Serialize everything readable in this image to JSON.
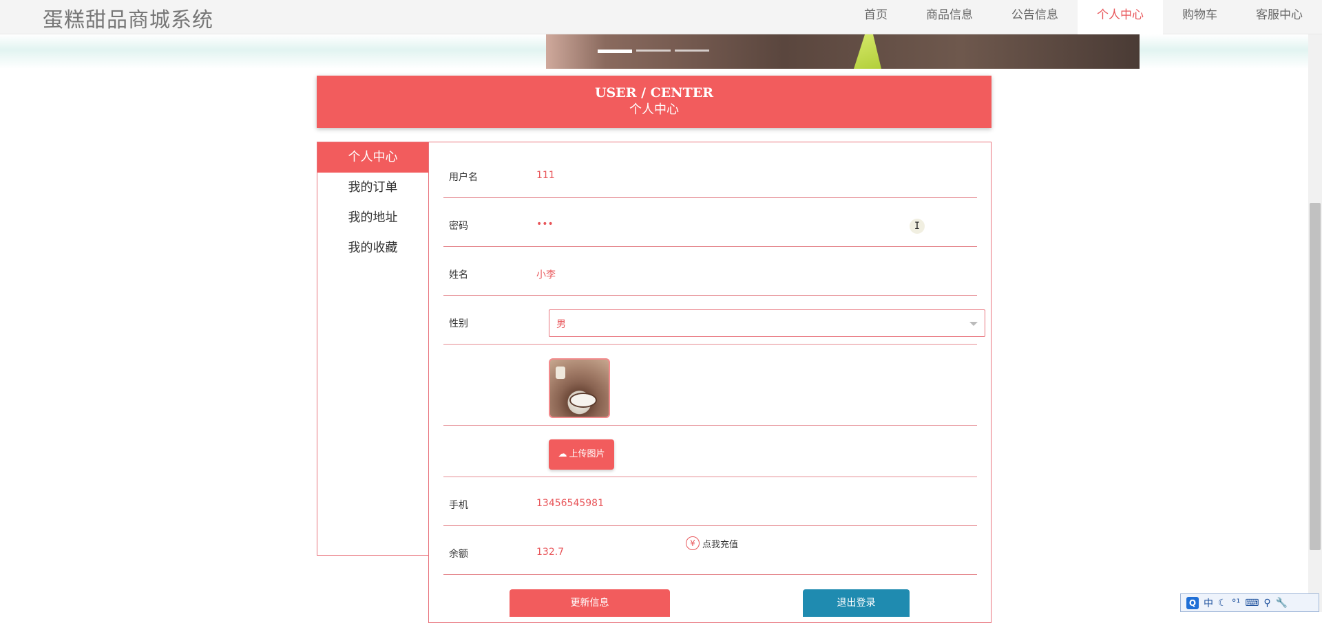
{
  "site": {
    "title": "蛋糕甜品商城系统"
  },
  "nav": {
    "items": [
      {
        "label": "首页"
      },
      {
        "label": "商品信息"
      },
      {
        "label": "公告信息"
      },
      {
        "label": "个人中心"
      },
      {
        "label": "购物车"
      },
      {
        "label": "客服中心"
      }
    ],
    "active_index": 3
  },
  "banner": {
    "dot_count": 3,
    "active_dot": 0
  },
  "section": {
    "title_en": "USER / CENTER",
    "title_cn": "个人中心"
  },
  "sidemenu": {
    "items": [
      {
        "label": "个人中心"
      },
      {
        "label": "我的订单"
      },
      {
        "label": "我的地址"
      },
      {
        "label": "我的收藏"
      }
    ],
    "active_index": 0
  },
  "form": {
    "username": {
      "label": "用户名",
      "value": "111"
    },
    "password": {
      "label": "密码",
      "value": "•••"
    },
    "name": {
      "label": "姓名",
      "value": "小李"
    },
    "gender": {
      "label": "性别",
      "value": "男"
    },
    "upload_label": "上传图片",
    "phone": {
      "label": "手机",
      "value": "13456545981"
    },
    "balance": {
      "label": "余额",
      "value": "132.7",
      "recharge_label": "点我充值"
    },
    "update_button": "更新信息",
    "logout_button": "退出登录"
  },
  "ime": {
    "q": "Q",
    "lang": "中",
    "moon": "☾",
    "punct": "°¹",
    "keyboard": "⌨",
    "more": "⚲",
    "tools": "🔧"
  },
  "colors": {
    "accent": "#f25c5d",
    "accent_text": "#e8565a",
    "logout": "#1f8bb0"
  }
}
